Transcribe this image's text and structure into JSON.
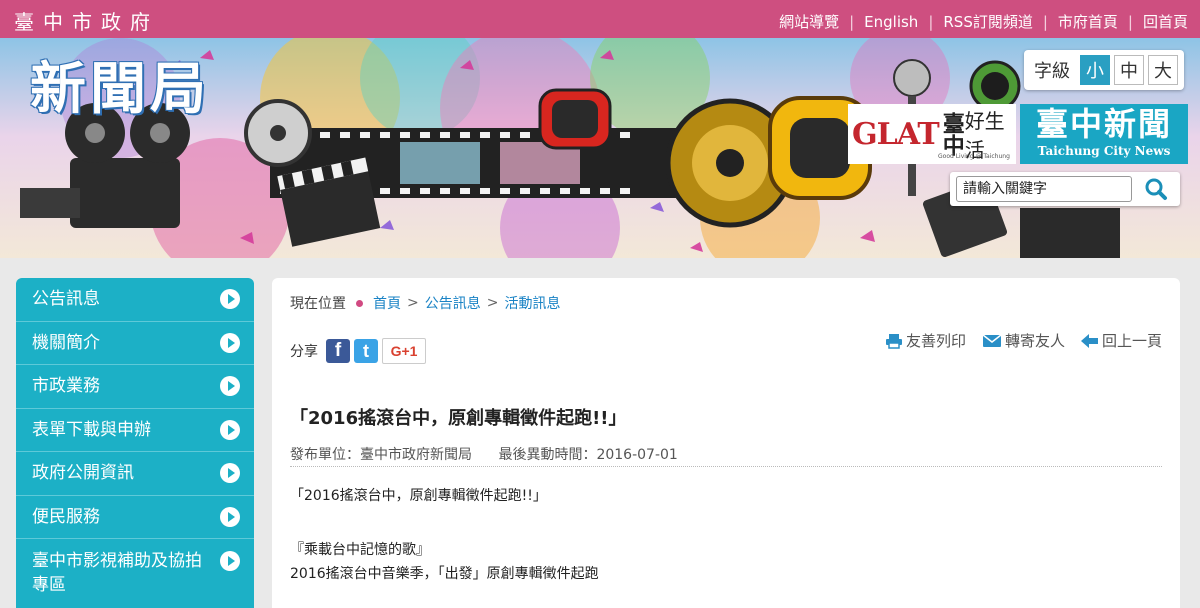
{
  "topbar": {
    "site_name": "臺中市政府",
    "links": [
      "網站導覽",
      "English",
      "RSS訂閱頻道",
      "市府首頁",
      "回首頁"
    ]
  },
  "banner": {
    "bureau": "新聞局",
    "font_size": {
      "label": "字級",
      "options": [
        "小",
        "中",
        "大"
      ],
      "selected": "小"
    },
    "glat_logo": {
      "brand": "GLAT",
      "city": "臺中",
      "tagline": "好生活",
      "small": "Good Living @ Taichung"
    },
    "news_logo": {
      "zh": "臺中新聞",
      "en": "Taichung City News"
    },
    "search": {
      "placeholder": "請輸入關鍵字"
    }
  },
  "sidebar": {
    "items": [
      {
        "label": "公告訊息"
      },
      {
        "label": "機關簡介"
      },
      {
        "label": "市政業務"
      },
      {
        "label": "表單下載與申辦"
      },
      {
        "label": "政府公開資訊"
      },
      {
        "label": "便民服務"
      },
      {
        "label": "臺中市影視補助及協拍專區"
      }
    ]
  },
  "breadcrumb": {
    "label": "現在位置",
    "items": [
      "首頁",
      "公告訊息",
      "活動訊息"
    ],
    "sep": ">"
  },
  "share": {
    "label": "分享",
    "fb": "f",
    "tw": "t",
    "gplus": "G+1"
  },
  "tools": {
    "print": "友善列印",
    "forward": "轉寄友人",
    "back": "回上一頁"
  },
  "article": {
    "title": "「2016搖滾台中，原創專輯徵件起跑!!」",
    "publisher": "發布單位：臺中市政府新聞局",
    "updated": "最後異動時間：2016-07-01",
    "lines": [
      "「2016搖滾台中，原創專輯徵件起跑!!」",
      "『乘載台中記憶的歌』",
      "2016搖滾台中音樂季，「出發」原創專輯徵件起跑"
    ]
  },
  "colors": {
    "topbar": "#ce4f80",
    "sidebar": "#1cb0c6",
    "link": "#1a83c5",
    "news_logo": "#1aa6c4"
  }
}
